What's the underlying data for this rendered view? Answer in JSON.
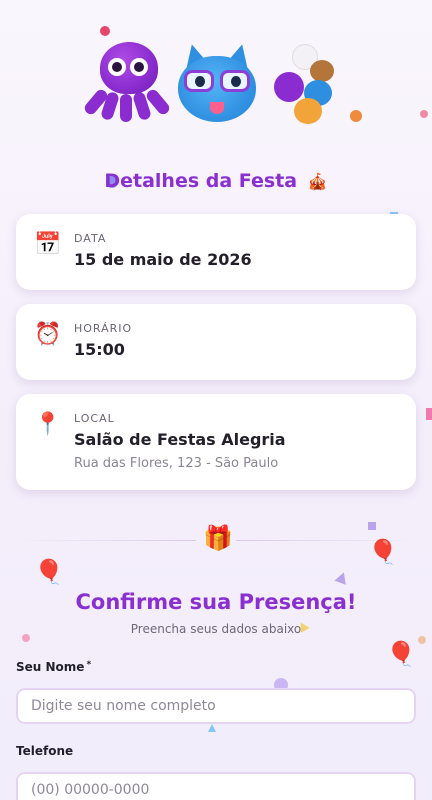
{
  "colors": {
    "accent": "#8a2fd0",
    "card_bg": "#ffffff",
    "input_border": "#e4d3f3"
  },
  "details": {
    "title": "Detalhes da Festa",
    "title_icon": "circus-tent-icon",
    "date": {
      "icon": "calendar-icon",
      "label": "DATA",
      "value": "15 de maio de 2026"
    },
    "time": {
      "icon": "alarm-clock-icon",
      "label": "HORÁRIO",
      "value": "15:00"
    },
    "location": {
      "icon": "pin-icon",
      "label": "LOCAL",
      "value": "Salão de Festas Alegria",
      "address": "Rua das Flores, 123 - São Paulo"
    }
  },
  "divider_icon": "gift-icon",
  "rsvp": {
    "title": "Confirme sua Presença!",
    "subtitle": "Preencha seus dados abaixo",
    "name": {
      "label": "Seu Nome",
      "required_mark": "*",
      "placeholder": "Digite seu nome completo",
      "value": ""
    },
    "phone": {
      "label": "Telefone",
      "placeholder": "(00) 00000-0000",
      "value": ""
    }
  }
}
